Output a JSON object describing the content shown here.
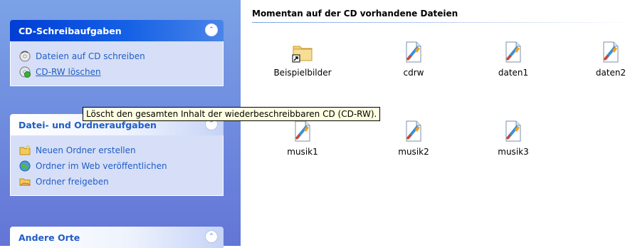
{
  "task_panels": {
    "cd": {
      "title": "CD-Schreibaufgaben",
      "items": [
        {
          "label": "Dateien auf CD schreiben",
          "icon": "write-cd-icon"
        },
        {
          "label": "CD-RW löschen",
          "icon": "erase-cd-icon"
        }
      ]
    },
    "file": {
      "title": "Datei- und Ordneraufgaben",
      "items": [
        {
          "label": "Neuen Ordner erstellen",
          "icon": "new-folder-icon"
        },
        {
          "label": "Ordner im Web veröffentlichen",
          "icon": "publish-web-icon"
        },
        {
          "label": "Ordner freigeben",
          "icon": "share-folder-icon"
        }
      ]
    },
    "other": {
      "title": "Andere Orte"
    }
  },
  "content": {
    "heading": "Momentan auf der CD vorhandene Dateien",
    "files": [
      {
        "name": "Beispielbilder",
        "icon": "folder-shortcut-icon"
      },
      {
        "name": "cdrw",
        "icon": "audio-file-icon"
      },
      {
        "name": "daten1",
        "icon": "audio-file-icon"
      },
      {
        "name": "daten2",
        "icon": "audio-file-icon"
      },
      {
        "name": "musik1",
        "icon": "audio-file-icon"
      },
      {
        "name": "musik2",
        "icon": "audio-file-icon"
      },
      {
        "name": "musik3",
        "icon": "audio-file-icon"
      }
    ]
  },
  "tooltip": "Löscht den gesamten Inhalt der wiederbeschreibbaren CD (CD-RW).",
  "colors": {
    "pane_gradient_top": "#7ba2e7",
    "pane_gradient_bottom": "#6375d6",
    "link_blue": "#215dc6",
    "panel_body": "#d6dff7",
    "tooltip_bg": "#ffffe1"
  }
}
